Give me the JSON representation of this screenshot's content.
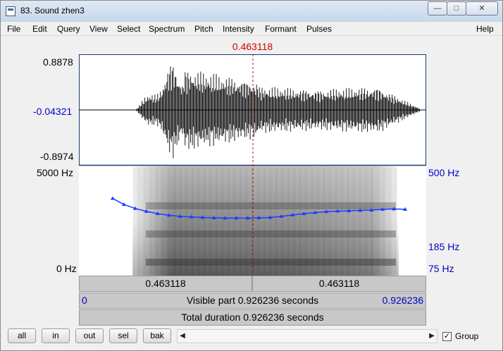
{
  "window": {
    "title": "83. Sound zhen3",
    "min_glyph": "—",
    "max_glyph": "□",
    "close_glyph": "✕"
  },
  "menu": [
    "File",
    "Edit",
    "Query",
    "View",
    "Select",
    "Spectrum",
    "Pitch",
    "Intensity",
    "Formant",
    "Pulses",
    "Help"
  ],
  "cursor": {
    "time": "0.463118"
  },
  "waveform": {
    "max_label": "0.8878",
    "zero_label": "-0.04321",
    "min_label": "-0.8974"
  },
  "spectrogram": {
    "top_label": "5000 Hz",
    "bottom_label": "0 Hz"
  },
  "pitch": {
    "top_label": "500 Hz",
    "mid_label": "185 Hz",
    "bottom_label": "75 Hz"
  },
  "time_bars": {
    "left_time": "0.463118",
    "right_time": "0.463118",
    "visible_start": "0",
    "visible_text": "Visible part 0.926236 seconds",
    "visible_end": "0.926236",
    "total_text": "Total duration 0.926236 seconds"
  },
  "buttons": {
    "all": "all",
    "in": "in",
    "out": "out",
    "sel": "sel",
    "bak": "bak"
  },
  "scroll": {
    "left_arrow": "◀",
    "right_arrow": "▶"
  },
  "group": {
    "label": "Group",
    "checked": true,
    "check_glyph": "✓"
  },
  "colors": {
    "cursor": "#d00000",
    "axis_blue": "#0000c8",
    "pitch_curve": "#1b3cff"
  },
  "pitch_track": [
    [
      0.09,
      272
    ],
    [
      0.12,
      243
    ],
    [
      0.15,
      226
    ],
    [
      0.18,
      214
    ],
    [
      0.21,
      205
    ],
    [
      0.24,
      199
    ],
    [
      0.27,
      195
    ],
    [
      0.3,
      193
    ],
    [
      0.33,
      191
    ],
    [
      0.36,
      190
    ],
    [
      0.39,
      189
    ],
    [
      0.42,
      189
    ],
    [
      0.45,
      189
    ],
    [
      0.48,
      190
    ],
    [
      0.51,
      191
    ],
    [
      0.54,
      195
    ],
    [
      0.57,
      200
    ],
    [
      0.6,
      205
    ],
    [
      0.63,
      209
    ],
    [
      0.66,
      213
    ],
    [
      0.69,
      215
    ],
    [
      0.72,
      216
    ],
    [
      0.75,
      218
    ],
    [
      0.78,
      219
    ],
    [
      0.81,
      222
    ],
    [
      0.84,
      224
    ],
    [
      0.87,
      222
    ]
  ]
}
